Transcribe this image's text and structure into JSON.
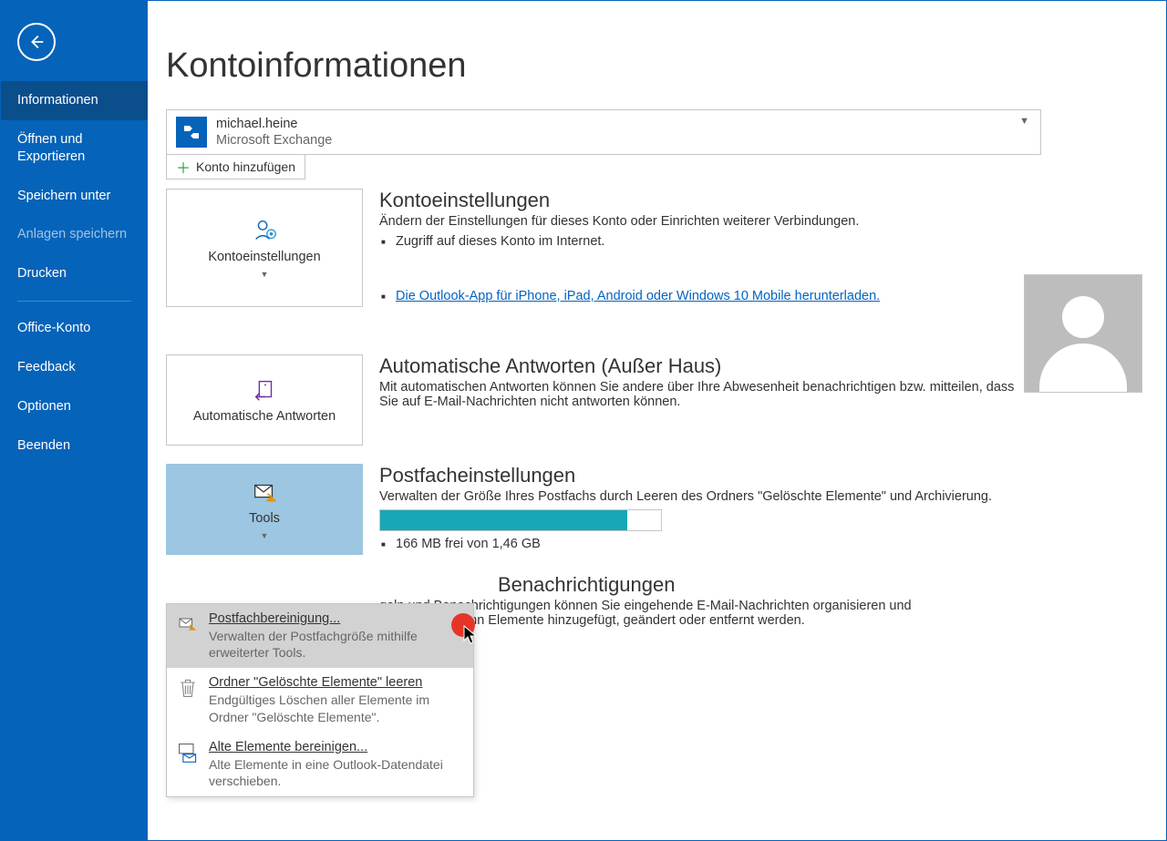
{
  "titlebar": {
    "help": "?",
    "min": "—",
    "max": "☐",
    "close": "✕"
  },
  "sidebar": {
    "items": [
      {
        "label": "Informationen",
        "active": true
      },
      {
        "label": "Öffnen und Exportieren"
      },
      {
        "label": "Speichern unter"
      },
      {
        "label": "Anlagen speichern",
        "disabled": true
      },
      {
        "label": "Drucken"
      },
      {
        "sep": true
      },
      {
        "label": "Office-Konto"
      },
      {
        "label": "Feedback"
      },
      {
        "label": "Optionen"
      },
      {
        "label": "Beenden"
      }
    ]
  },
  "page_title": "Kontoinformationen",
  "account": {
    "user": "michael.heine",
    "server": "Microsoft Exchange"
  },
  "add_account": "Konto hinzufügen",
  "tiles": {
    "settings": "Kontoeinstellungen",
    "autoreply": "Automatische Antworten",
    "tools": "Tools"
  },
  "s1": {
    "title": "Kontoeinstellungen",
    "desc": "Ändern der Einstellungen für dieses Konto oder Einrichten weiterer Verbindungen.",
    "b1": "Zugriff auf dieses Konto im Internet.",
    "link": "Die Outlook-App für iPhone, iPad, Android oder Windows 10 Mobile herunterladen."
  },
  "s2": {
    "title": "Automatische Antworten (Außer Haus)",
    "desc": "Mit automatischen Antworten können Sie andere über Ihre Abwesenheit benachrichtigen bzw. mitteilen, dass Sie auf E-Mail-Nachrichten nicht antworten können."
  },
  "s3": {
    "title": "Postfacheinstellungen",
    "desc": "Verwalten der Größe Ihres Postfachs durch Leeren des Ordners \"Gelöschte Elemente\" und Archivierung.",
    "usage": "166 MB frei von 1,46 GB"
  },
  "s4": {
    "title": "Benachrichtigungen",
    "desc": "geln und Benachrichtigungen können Sie eingehende E-Mail-Nachrichten organisieren und empfangen, wenn Elemente hinzugefügt, geändert oder entfernt werden."
  },
  "menu": {
    "m1": {
      "title": "Postfachbereinigung...",
      "desc": "Verwalten der Postfachgröße mithilfe erweiterter Tools."
    },
    "m2": {
      "title": "Ordner \"Gelöschte Elemente\" leeren",
      "desc": "Endgültiges Löschen aller Elemente im Ordner \"Gelöschte Elemente\"."
    },
    "m3": {
      "title": "Alte Elemente bereinigen...",
      "desc": "Alte Elemente in eine Outlook-Datendatei verschieben."
    }
  }
}
